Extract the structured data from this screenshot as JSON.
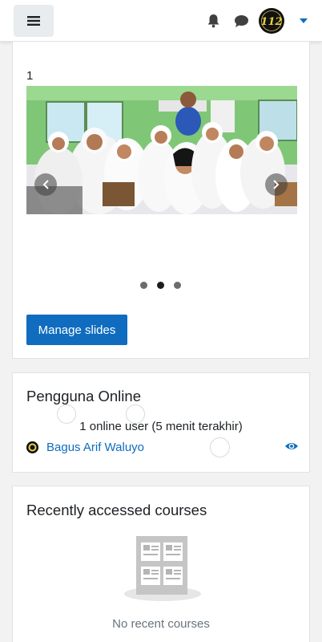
{
  "header": {
    "menu_icon": "hamburger-icon",
    "notifications_icon": "bell-icon",
    "messages_icon": "chat-bubble-icon",
    "user_avatar_text": "112",
    "user_menu_icon": "caret-down-icon"
  },
  "slider": {
    "slide_number": "1",
    "active_dot": 2,
    "dot_count": 3,
    "manage_button": "Manage slides"
  },
  "online_users": {
    "title": "Pengguna Online",
    "summary": "1 online user (5 menit terakhir)",
    "users": [
      {
        "name": "Bagus Arif Waluyo"
      }
    ]
  },
  "recent_courses": {
    "title": "Recently accessed courses",
    "empty_message": "No recent courses"
  },
  "colors": {
    "primary": "#0f6cbf",
    "page_bg": "#f2f2f2",
    "card_bg": "#ffffff"
  }
}
